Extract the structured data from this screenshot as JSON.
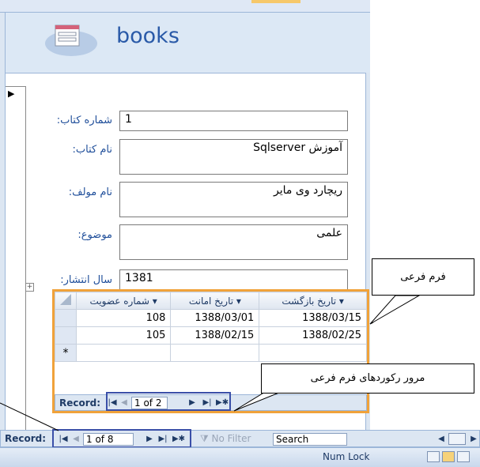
{
  "form": {
    "title": "books",
    "fields": [
      {
        "label": "شماره کتاب:",
        "value": "1"
      },
      {
        "label": "نام کتاب:",
        "value": "آموزش Sqlserver"
      },
      {
        "label": "نام مولف:",
        "value": "ریچارد وی مایر"
      },
      {
        "label": "موضوع:",
        "value": "علمی"
      },
      {
        "label": "سال انتشار:",
        "value": "1381"
      }
    ]
  },
  "subform": {
    "columns": [
      "شماره عضویت",
      "تاریخ امانت",
      "تاریخ بازگشت"
    ],
    "rows": [
      [
        "108",
        "1388/03/01",
        "1388/03/15"
      ],
      [
        "105",
        "1388/02/15",
        "1388/02/25"
      ]
    ],
    "new_row_marker": "*",
    "nav": {
      "label": "Record:",
      "position": "1 of 2",
      "first": "|◀",
      "prev": "◀",
      "next": "▶",
      "last": "▶|",
      "new": "▶✱"
    }
  },
  "main_nav": {
    "label": "Record:",
    "position": "1 of 8",
    "first": "|◀",
    "prev": "◀",
    "next": "▶",
    "last": "▶|",
    "new": "▶✱",
    "filter": "No Filter",
    "search": "Search"
  },
  "status": {
    "numlock": "Num Lock"
  },
  "callouts": {
    "subform": "فرم فرعی",
    "subform_nav": "مرور رکوردهای فرم فرعی"
  },
  "colors": {
    "highlight": "#f0a23a",
    "nav_box": "#3a4fa8",
    "title": "#2a5aa8"
  }
}
